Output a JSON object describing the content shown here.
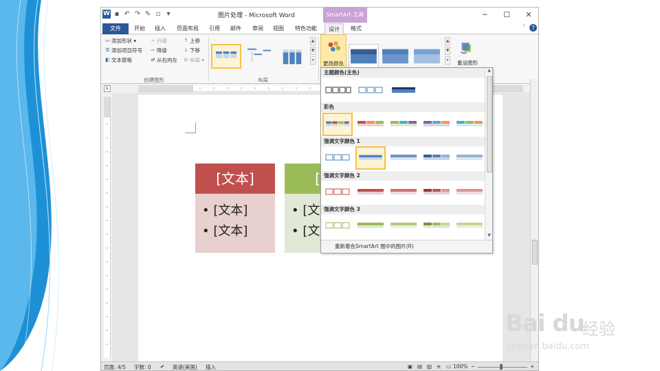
{
  "window": {
    "title": "图片处理 - Microsoft Word",
    "context_tab": "SmartArt 工具",
    "minimize": "─",
    "maximize": "☐",
    "close": "✕",
    "qat_logo": "W"
  },
  "tabs": [
    "文件",
    "开始",
    "插入",
    "页面布局",
    "引用",
    "邮件",
    "审阅",
    "视图",
    "特色功能",
    "设计",
    "格式"
  ],
  "ribbon": {
    "create_group": {
      "add_shape": "添加形状 ▾",
      "add_bullet": "添加项目符号",
      "text_pane": "文本窗格",
      "promote": "升级",
      "demote": "降级",
      "right_to_left": "从右向左",
      "move_up": "上移",
      "move_down": "下移",
      "layout": "布局 ▾",
      "label": "创建图形"
    },
    "layout_group": {
      "label": "布局"
    },
    "change_colors": "更改颜色",
    "reset_graphic": "重设图形"
  },
  "document": {
    "card_title": "[文本]",
    "bullet1": "• [文本]",
    "bullet2": "• [文本]",
    "card2_title": "[文",
    "card2_bullet1": "• [文",
    "card2_bullet2": "• [文",
    "colors": {
      "red": "#c0504d",
      "red_light": "#e8d0cf",
      "green": "#9bbb59",
      "green_light": "#e1e9d6"
    }
  },
  "color_popup": {
    "section_primary": "主题颜色(主色)",
    "section_colorful": "彩色",
    "section_accent1": "强调文字颜色 1",
    "section_accent2": "强调文字颜色 2",
    "section_accent3": "强调文字颜色 3",
    "footer": "重新着色SmartArt 图中的图片(R)"
  },
  "statusbar": {
    "page": "页面: 4/5",
    "words": "字数: 0",
    "language": "英语(美国)",
    "mode": "插入",
    "zoom": "100%"
  },
  "watermark": {
    "brand": "Bai du",
    "jingyan": "经验",
    "url": "jingyan.baidu.com"
  }
}
